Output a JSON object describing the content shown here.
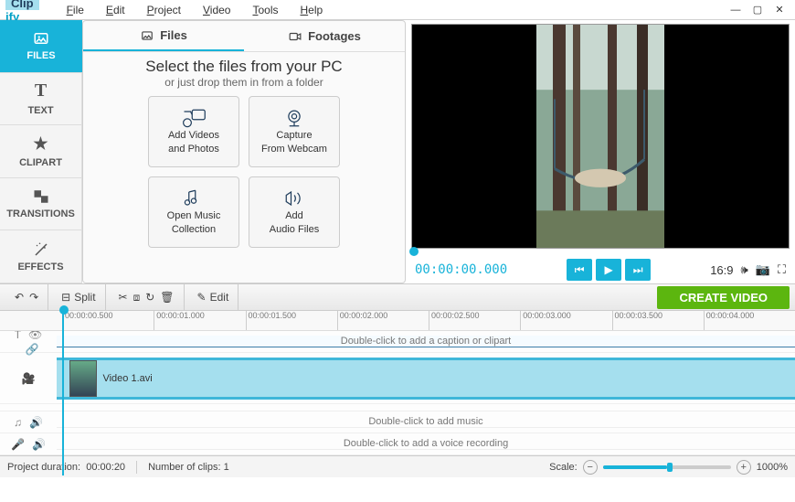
{
  "app": {
    "name_a": "Clip",
    "name_b": "ify"
  },
  "menu": [
    "File",
    "Edit",
    "Project",
    "Video",
    "Tools",
    "Help"
  ],
  "left_tabs": [
    {
      "label": "FILES",
      "active": true
    },
    {
      "label": "TEXT"
    },
    {
      "label": "CLIPART"
    },
    {
      "label": "TRANSITIONS"
    },
    {
      "label": "EFFECTS"
    }
  ],
  "files_panel": {
    "tabs": [
      {
        "label": "Files",
        "active": true
      },
      {
        "label": "Footages"
      }
    ],
    "title": "Select the files from your PC",
    "sub": "or just drop them in from a folder",
    "tiles": [
      {
        "l1": "Add Videos",
        "l2": "and Photos"
      },
      {
        "l1": "Capture",
        "l2": "From Webcam"
      },
      {
        "l1": "Open Music",
        "l2": "Collection"
      },
      {
        "l1": "Add",
        "l2": "Audio Files"
      }
    ]
  },
  "player": {
    "time": "00:00:00.000",
    "ratio": "16:9"
  },
  "toolbar": {
    "split": "Split",
    "edit": "Edit",
    "create": "CREATE VIDEO"
  },
  "ruler": [
    "00:00:00.500",
    "00:00:01.000",
    "00:00:01.500",
    "00:00:02.000",
    "00:00:02.500",
    "00:00:03.000",
    "00:00:03.500",
    "00:00:04.000"
  ],
  "tracks": {
    "caption_hint": "Double-click to add a caption or clipart",
    "clip_name": "Video 1.avi",
    "music_hint": "Double-click to add music",
    "voice_hint": "Double-click to add a voice recording"
  },
  "status": {
    "duration_label": "Project duration:",
    "duration": "00:00:20",
    "clips_label": "Number of clips:",
    "clips": "1",
    "scale_label": "Scale:",
    "scale_value": "1000%"
  }
}
